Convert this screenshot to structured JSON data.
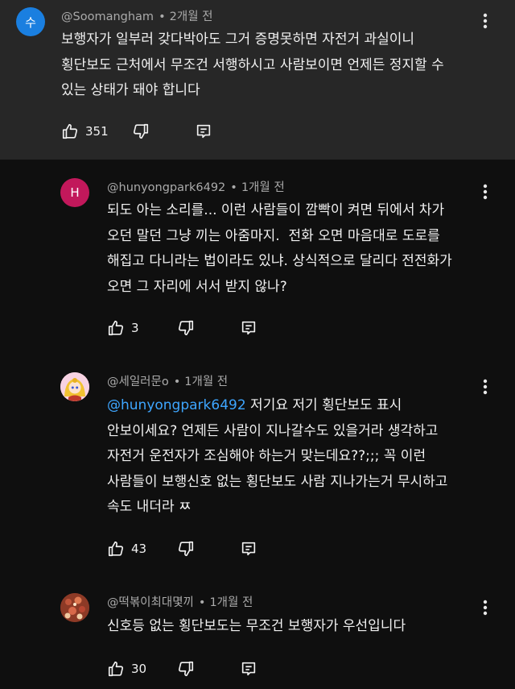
{
  "comments": [
    {
      "avatar_letter": "수",
      "avatar_color": "#1a7fe0",
      "author": "@Soomangham",
      "time": "2개월 전",
      "lines": [
        "보행자가 일부러 갖다박아도 그거 증명못하면 자전거 과실이니",
        "횡단보도 근처에서 무조건 서행하시고 사람보이면 언제든 정지할 수",
        "있는 상태가 돼야 합니다"
      ],
      "likes": "351"
    },
    {
      "avatar_letter": "H",
      "avatar_color": "#c2185b",
      "author": "@hunyongpark6492",
      "time": "1개월 전",
      "lines": [
        "되도 아는 소리를... 이런 사람들이 깜빡이 켜면 뒤에서 차가",
        "오던 말던 그냥 끼는 아줌마지.  전화 오면 마음대로 도로를",
        "해집고 다니라는 법이라도 있냐. 상식적으로 달리다 전전화가",
        "오면 그 자리에 서서 받지 않나?"
      ],
      "likes": "3"
    },
    {
      "author": "@세일러문o",
      "time": "1개월 전",
      "mention": "@hunyongpark6492",
      "first_line_rest": " 저기요 저기 횡단보도 표시",
      "lines": [
        "안보이세요? 언제든 사람이 지나갈수도 있을거라 생각하고",
        "자전거 운전자가 조심해야 하는거 맞는데요??;;; 꼭 이런",
        "사람들이 보행신호 없는 횡단보도 사람 지나가는거 무시하고",
        "속도 내더라 ㅉ"
      ],
      "likes": "43"
    },
    {
      "author": "@떡볶이최대몇끼",
      "time": "1개월 전",
      "lines": [
        "신호등 없는 횡단보도는 무조건 보행자가 우선입니다"
      ],
      "likes": "30"
    }
  ],
  "icons": {
    "like": "thumbs-up-icon",
    "dislike": "thumbs-down-icon",
    "reply": "reply-comment-icon",
    "menu": "more-vertical-icon"
  }
}
